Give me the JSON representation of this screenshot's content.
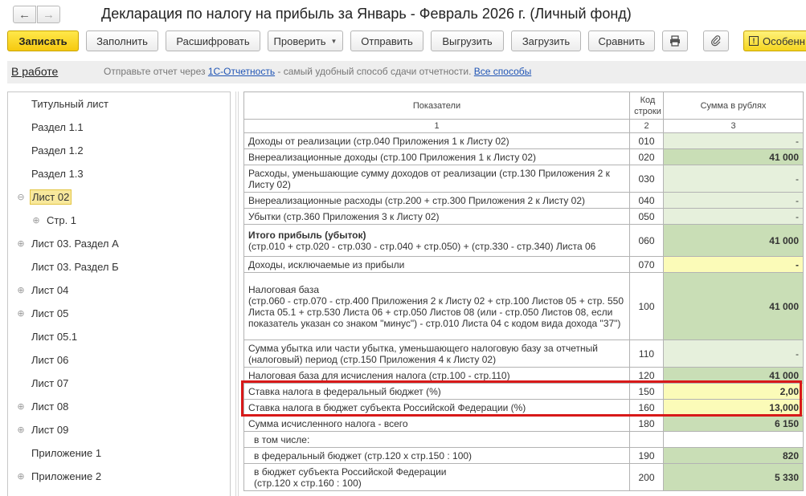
{
  "title": "Декларация по налогу на прибыль за Январь - Февраль 2026 г. (Личный фонд)",
  "nav": {
    "back_icon": "arrow-left-icon",
    "forward_icon": "arrow-right-icon"
  },
  "toolbar": {
    "save": "Записать",
    "fill": "Заполнить",
    "decode": "Расшифровать",
    "check": "Проверить",
    "send": "Отправить",
    "upload": "Выгрузить",
    "load": "Загрузить",
    "compare": "Сравнить",
    "print_icon": "printer-icon",
    "attach_icon": "paperclip-icon",
    "features": "Особенн"
  },
  "infobar": {
    "status": "В работе",
    "text_before": "Отправьте отчет через ",
    "link1": "1С-Отчетность",
    "text_after": " - самый удобный способ сдачи отчетности. ",
    "link2": "Все способы"
  },
  "tree": [
    {
      "label": "Титульный лист",
      "expander": ""
    },
    {
      "label": "Раздел 1.1",
      "expander": ""
    },
    {
      "label": "Раздел 1.2",
      "expander": ""
    },
    {
      "label": "Раздел 1.3",
      "expander": ""
    },
    {
      "label": "Лист 02",
      "expander": "⊖"
    },
    {
      "label": "Стр. 1",
      "expander": "⊕"
    },
    {
      "label": "Лист 03. Раздел А",
      "expander": "⊕"
    },
    {
      "label": "Лист 03. Раздел Б",
      "expander": ""
    },
    {
      "label": "Лист 04",
      "expander": "⊕"
    },
    {
      "label": "Лист 05",
      "expander": "⊕"
    },
    {
      "label": "Лист 05.1",
      "expander": ""
    },
    {
      "label": "Лист 06",
      "expander": ""
    },
    {
      "label": "Лист 07",
      "expander": ""
    },
    {
      "label": "Лист 08",
      "expander": "⊕"
    },
    {
      "label": "Лист 09",
      "expander": "⊕"
    },
    {
      "label": "Приложение 1",
      "expander": ""
    },
    {
      "label": "Приложение 2",
      "expander": "⊕"
    }
  ],
  "table": {
    "headers": [
      "Показатели",
      "Код строки",
      "Сумма в рублях"
    ],
    "numbers": [
      "1",
      "2",
      "3"
    ],
    "rows": [
      {
        "label": "Доходы от реализации (стр.040 Приложения 1 к Листу 02)",
        "code": "010",
        "value": "-"
      },
      {
        "label": "Внереализационные доходы (стр.100 Приложения 1 к Листу 02)",
        "code": "020",
        "value": "41 000"
      },
      {
        "label": "Расходы, уменьшающие сумму доходов от реализации (стр.130 Приложения 2 к Листу 02)",
        "code": "030",
        "value": "-"
      },
      {
        "label": "Внереализационные расходы (стр.200 + стр.300 Приложения 2 к Листу 02)",
        "code": "040",
        "value": "-"
      },
      {
        "label": "Убытки (стр.360 Приложения 3 к Листу 02)",
        "code": "050",
        "value": "-"
      },
      {
        "label": "Итого прибыль (убыток)",
        "sub": "(стр.010 + стр.020 - стр.030 - стр.040 + стр.050) + (стр.330 - стр.340) Листа 06",
        "code": "060",
        "value": "41 000"
      },
      {
        "label": "Доходы, исключаемые из прибыли",
        "code": "070",
        "value": "-"
      },
      {
        "label": "Налоговая база",
        "sub": "(стр.060 - стр.070 - стр.400 Приложения 2 к Листу 02 + стр.100 Листов 05 + стр. 550 Листа 05.1 + стр.530 Листа 06 + стр.050 Листов 08 (или - стр.050 Листов 08, если показатель указан со знаком \"минус\") - стр.010 Листа 04 с кодом вида дохода \"37\")",
        "code": "100",
        "value": "41 000"
      },
      {
        "label": "Сумма убытка или части убытка, уменьшающего налоговую базу за отчетный (налоговый) период (стр.150 Приложения 4 к Листу 02)",
        "code": "110",
        "value": "-"
      },
      {
        "label": "Налоговая база для исчисления налога (стр.100 - стр.110)",
        "code": "120",
        "value": "41 000"
      },
      {
        "label": "Ставка налога в федеральный бюджет (%)",
        "code": "150",
        "value": "2,00"
      },
      {
        "label": "Ставка налога в бюджет субъекта Российской Федерации (%)",
        "code": "160",
        "value": "13,000"
      },
      {
        "label": "Сумма исчисленного налога - всего",
        "code": "180",
        "value": "6 150"
      },
      {
        "label": "в том числе:",
        "code": "",
        "value": ""
      },
      {
        "label": "в федеральный бюджет (стр.120 х стр.150 : 100)",
        "code": "190",
        "value": "820"
      },
      {
        "label": "в бюджет субъекта Российской Федерации",
        "sub": "(стр.120 х стр.160 : 100)",
        "code": "200",
        "value": "5 330"
      }
    ]
  }
}
